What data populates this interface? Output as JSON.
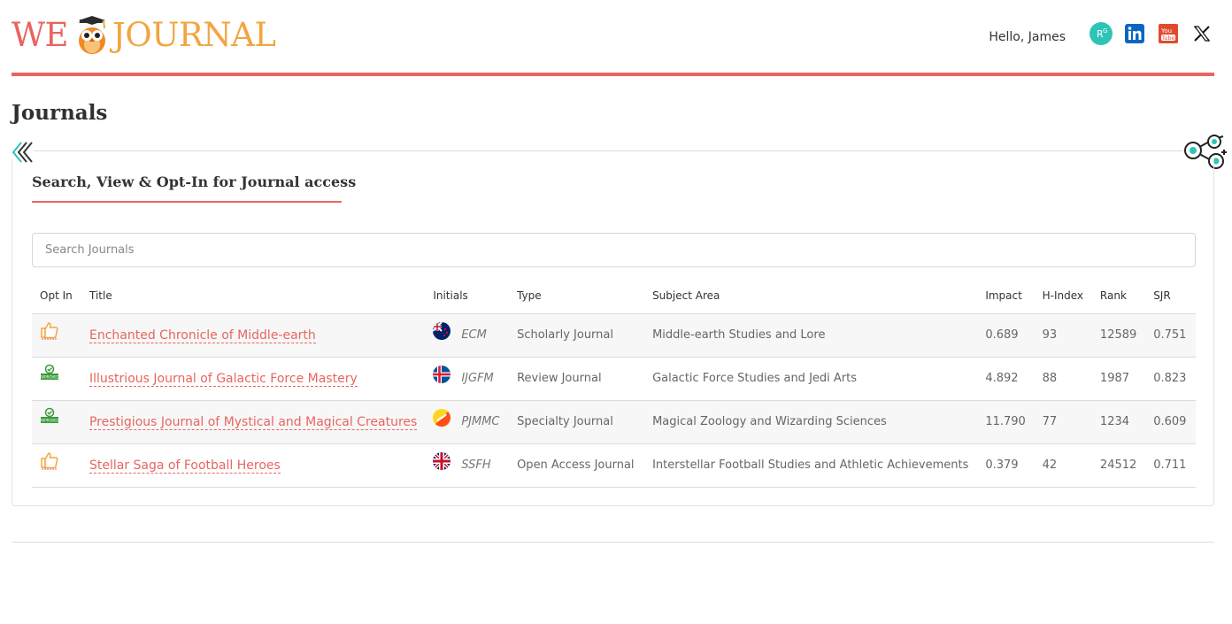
{
  "brand": {
    "we": "WE",
    "journal": "JOURNAL"
  },
  "header": {
    "greeting": "Hello, James",
    "social": [
      "researchgate-icon",
      "linkedin-icon",
      "youtube-icon",
      "x-icon"
    ]
  },
  "page": {
    "title": "Journals",
    "section_title": "Search, View & Opt-In for Journal access"
  },
  "search": {
    "placeholder": "Search Journals",
    "value": ""
  },
  "table": {
    "headers": {
      "opt_in": "Opt In",
      "title": "Title",
      "initials": "Initials",
      "type": "Type",
      "subject": "Subject Area",
      "impact": "Impact",
      "h_index": "H-Index",
      "rank": "Rank",
      "sjr": "SJR"
    },
    "rows": [
      {
        "opt_in": "thumbs-up-icon",
        "title": "Enchanted Chronicle of Middle-earth",
        "flag": "new-zealand-flag",
        "initials": "ECM",
        "type": "Scholarly Journal",
        "subject": "Middle-earth Studies and Lore",
        "impact": "0.689",
        "h_index": "93",
        "rank": "12589",
        "sjr": "0.751"
      },
      {
        "opt_in": "approved-icon",
        "title": "Illustrious Journal of Galactic Force Mastery",
        "flag": "iceland-flag",
        "initials": "IJGFM",
        "type": "Review Journal",
        "subject": "Galactic Force Studies and Jedi Arts",
        "impact": "4.892",
        "h_index": "88",
        "rank": "1987",
        "sjr": "0.823"
      },
      {
        "opt_in": "approved-icon",
        "title": "Prestigious Journal of Mystical and Magical Creatures",
        "flag": "bhutan-flag",
        "initials": "PJMMC",
        "type": "Specialty Journal",
        "subject": "Magical Zoology and Wizarding Sciences",
        "impact": "11.790",
        "h_index": "77",
        "rank": "1234",
        "sjr": "0.609"
      },
      {
        "opt_in": "thumbs-up-icon",
        "title": "Stellar Saga of Football Heroes",
        "flag": "uk-flag",
        "initials": "SSFH",
        "type": "Open Access Journal",
        "subject": "Interstellar Football Studies and Athletic Achievements",
        "impact": "0.379",
        "h_index": "42",
        "rank": "24512",
        "sjr": "0.711"
      }
    ]
  },
  "colors": {
    "accent": "#e8655f",
    "brand_orange": "#f2a541",
    "teal": "#2ec4b6"
  }
}
